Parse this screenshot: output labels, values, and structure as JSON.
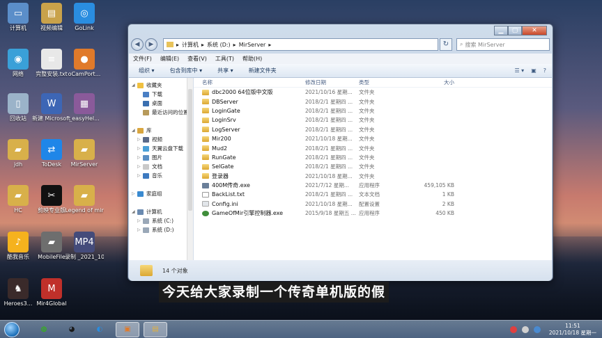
{
  "desktop_icons": [
    {
      "label": "计算机",
      "color": "#5b8ec9",
      "glyph": "▭"
    },
    {
      "label": "视频编辑",
      "color": "#c9a24a",
      "glyph": "▤"
    },
    {
      "label": "GoLink",
      "color": "#2a8de0",
      "glyph": "◎"
    },
    {
      "label": "网络",
      "color": "#3aa0d8",
      "glyph": "◉"
    },
    {
      "label": "完整安装.txt",
      "color": "#e8e8e8",
      "glyph": "≡"
    },
    {
      "label": "oCamPort...",
      "color": "#e07a2a",
      "glyph": "●"
    },
    {
      "label": "回收站",
      "color": "#9bb3c9",
      "glyph": "▯"
    },
    {
      "label": "新建 Microsoft...",
      "color": "#3d66b5",
      "glyph": "W"
    },
    {
      "label": "_easyHel...",
      "color": "#8a5a9a",
      "glyph": "▦"
    },
    {
      "label": "jdh",
      "color": "#d8b04a",
      "glyph": "▰"
    },
    {
      "label": "ToDesk",
      "color": "#1f86e8",
      "glyph": "⇄"
    },
    {
      "label": "MirServer",
      "color": "#d8b04a",
      "glyph": "▰"
    },
    {
      "label": "HC",
      "color": "#d8b04a",
      "glyph": "▰"
    },
    {
      "label": "剪映专业版",
      "color": "#111111",
      "glyph": "✂"
    },
    {
      "label": "Legend of mir",
      "color": "#d8b04a",
      "glyph": "▰"
    },
    {
      "label": "酷我音乐",
      "color": "#f5b21e",
      "glyph": "♪"
    },
    {
      "label": "MobileFile",
      "color": "#6e6e6e",
      "glyph": "▰"
    },
    {
      "label": "录制 _2021_10_...",
      "color": "#444b7a",
      "glyph": "MP4"
    },
    {
      "label": "Heroes3...",
      "color": "#3a2a2a",
      "glyph": "♞"
    },
    {
      "label": "Mir4Global",
      "color": "#c0302a",
      "glyph": "M"
    }
  ],
  "window": {
    "breadcrumb": [
      "计算机",
      "系统 (D:)",
      "MirServer"
    ],
    "search_placeholder": "搜索 MirServer",
    "min": "▁",
    "max": "▢",
    "close": "✕",
    "back": "◀",
    "forward": "▶",
    "refresh": "↻",
    "menu": [
      "文件(F)",
      "编辑(E)",
      "查看(V)",
      "工具(T)",
      "帮助(H)"
    ],
    "toolbar": {
      "organize": "组织 ▾",
      "include": "包含到库中 ▾",
      "share": "共享 ▾",
      "new_folder": "新建文件夹",
      "view_icon": "☰ ▾",
      "pane_icon": "▣",
      "help_icon": "?"
    },
    "nav": [
      {
        "label": "收藏夹",
        "indent": 0,
        "color": "#f0c040",
        "expand": "◢"
      },
      {
        "label": "下载",
        "indent": 1,
        "color": "#4a7fc4",
        "expand": ""
      },
      {
        "label": "桌面",
        "indent": 1,
        "color": "#3a6fb0",
        "expand": ""
      },
      {
        "label": "最近访问的位置",
        "indent": 1,
        "color": "#b79a5a",
        "expand": ""
      },
      {
        "label": "",
        "indent": 0,
        "color": "",
        "expand": ""
      },
      {
        "label": "库",
        "indent": 0,
        "color": "#d9a640",
        "expand": "◢"
      },
      {
        "label": "视频",
        "indent": 1,
        "color": "#5a6a8a",
        "expand": "▷"
      },
      {
        "label": "天翼云盘下载",
        "indent": 1,
        "color": "#4aa0d8",
        "expand": "▷"
      },
      {
        "label": "图片",
        "indent": 1,
        "color": "#5a8fc4",
        "expand": "▷"
      },
      {
        "label": "文档",
        "indent": 1,
        "color": "#c9c9c9",
        "expand": "▷"
      },
      {
        "label": "音乐",
        "indent": 1,
        "color": "#3d7ac0",
        "expand": "▷"
      },
      {
        "label": "",
        "indent": 0,
        "color": "",
        "expand": ""
      },
      {
        "label": "家庭组",
        "indent": 0,
        "color": "#3a8ad0",
        "expand": "▷"
      },
      {
        "label": "",
        "indent": 0,
        "color": "",
        "expand": ""
      },
      {
        "label": "计算机",
        "indent": 0,
        "color": "#6a8ab0",
        "expand": "◢"
      },
      {
        "label": "系统 (C:)",
        "indent": 1,
        "color": "#9aa8b8",
        "expand": "▷"
      },
      {
        "label": "系统 (D:)",
        "indent": 1,
        "color": "#9aa8b8",
        "expand": "▷"
      }
    ],
    "columns": {
      "name": "名称",
      "date": "修改日期",
      "type": "类型",
      "size": "大小"
    },
    "files": [
      {
        "name": "dbc2000 64位版中文版",
        "date": "2021/10/16 星期...",
        "type": "文件夹",
        "size": "",
        "icon": "folder"
      },
      {
        "name": "DBServer",
        "date": "2018/2/1 星期四 ...",
        "type": "文件夹",
        "size": "",
        "icon": "folder"
      },
      {
        "name": "LoginGate",
        "date": "2018/2/1 星期四 ...",
        "type": "文件夹",
        "size": "",
        "icon": "folder"
      },
      {
        "name": "LoginSrv",
        "date": "2018/2/1 星期四 ...",
        "type": "文件夹",
        "size": "",
        "icon": "folder"
      },
      {
        "name": "LogServer",
        "date": "2018/2/1 星期四 ...",
        "type": "文件夹",
        "size": "",
        "icon": "folder"
      },
      {
        "name": "Mir200",
        "date": "2021/10/18 星期...",
        "type": "文件夹",
        "size": "",
        "icon": "folder"
      },
      {
        "name": "Mud2",
        "date": "2018/2/1 星期四 ...",
        "type": "文件夹",
        "size": "",
        "icon": "folder"
      },
      {
        "name": "RunGate",
        "date": "2018/2/1 星期四 ...",
        "type": "文件夹",
        "size": "",
        "icon": "folder"
      },
      {
        "name": "SelGate",
        "date": "2018/2/1 星期四 ...",
        "type": "文件夹",
        "size": "",
        "icon": "folder"
      },
      {
        "name": "登录器",
        "date": "2021/10/18 星期...",
        "type": "文件夹",
        "size": "",
        "icon": "folder"
      },
      {
        "name": "400M传奇.exe",
        "date": "2021/7/12 星期...",
        "type": "应用程序",
        "size": "459,105 KB",
        "icon": "exe"
      },
      {
        "name": "BackList.txt",
        "date": "2018/2/1 星期四 ...",
        "type": "文本文档",
        "size": "1 KB",
        "icon": "txt"
      },
      {
        "name": "Config.ini",
        "date": "2021/10/18 星期...",
        "type": "配置设置",
        "size": "2 KB",
        "icon": "ini"
      },
      {
        "name": "GameOfMir引擎控制器.exe",
        "date": "2015/9/18 星期五 ...",
        "type": "应用程序",
        "size": "450 KB",
        "icon": "game"
      }
    ],
    "status_text": "14 个对象"
  },
  "subtitle": "今天给大家录制一个传奇单机版的假",
  "taskbar": {
    "apps": [
      {
        "name": "wechat",
        "glyph": "◍",
        "color": "#2dc100"
      },
      {
        "name": "qq",
        "glyph": "◕",
        "color": "#1a1a1a"
      },
      {
        "name": "browser",
        "glyph": "◐",
        "color": "#2a8de0"
      },
      {
        "name": "ocam",
        "glyph": "▣",
        "color": "#e07a2a"
      },
      {
        "name": "explorer",
        "glyph": "▤",
        "color": "#e0b040"
      }
    ],
    "time": "11:51",
    "date": "2021/10/18 星期一"
  }
}
